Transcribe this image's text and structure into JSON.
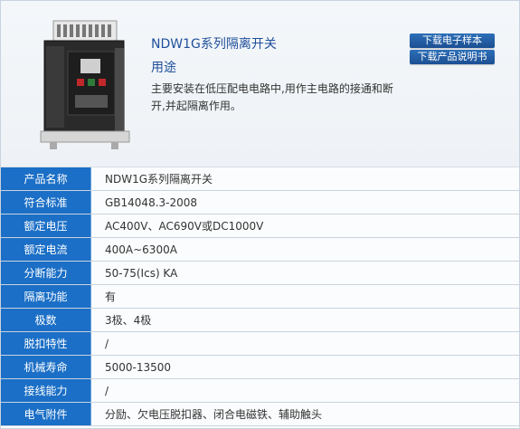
{
  "product": {
    "title": "NDW1G系列隔离开关",
    "subtitle": "用途",
    "description": "主要安装在低压配电电路中,用作主电路的接通和断开,并起隔离作用。"
  },
  "actions": {
    "download_sample": "下载电子样本",
    "download_manual": "下载产品说明书"
  },
  "specs": [
    {
      "label": "产品名称",
      "value": "NDW1G系列隔离开关"
    },
    {
      "label": "符合标准",
      "value": "GB14048.3-2008"
    },
    {
      "label": "额定电压",
      "value": "AC400V、AC690V或DC1000V"
    },
    {
      "label": "额定电流",
      "value": "400A~6300A"
    },
    {
      "label": "分断能力",
      "value": "50-75(Ics) KA"
    },
    {
      "label": "隔离功能",
      "value": "有"
    },
    {
      "label": "极数",
      "value": "3极、4极"
    },
    {
      "label": "脱扣特性",
      "value": "/"
    },
    {
      "label": "机械寿命",
      "value": "5000-13500"
    },
    {
      "label": "接线能力",
      "value": "/"
    },
    {
      "label": "电气附件",
      "value": "分励、欠电压脱扣器、闭合电磁铁、辅助触头"
    }
  ]
}
